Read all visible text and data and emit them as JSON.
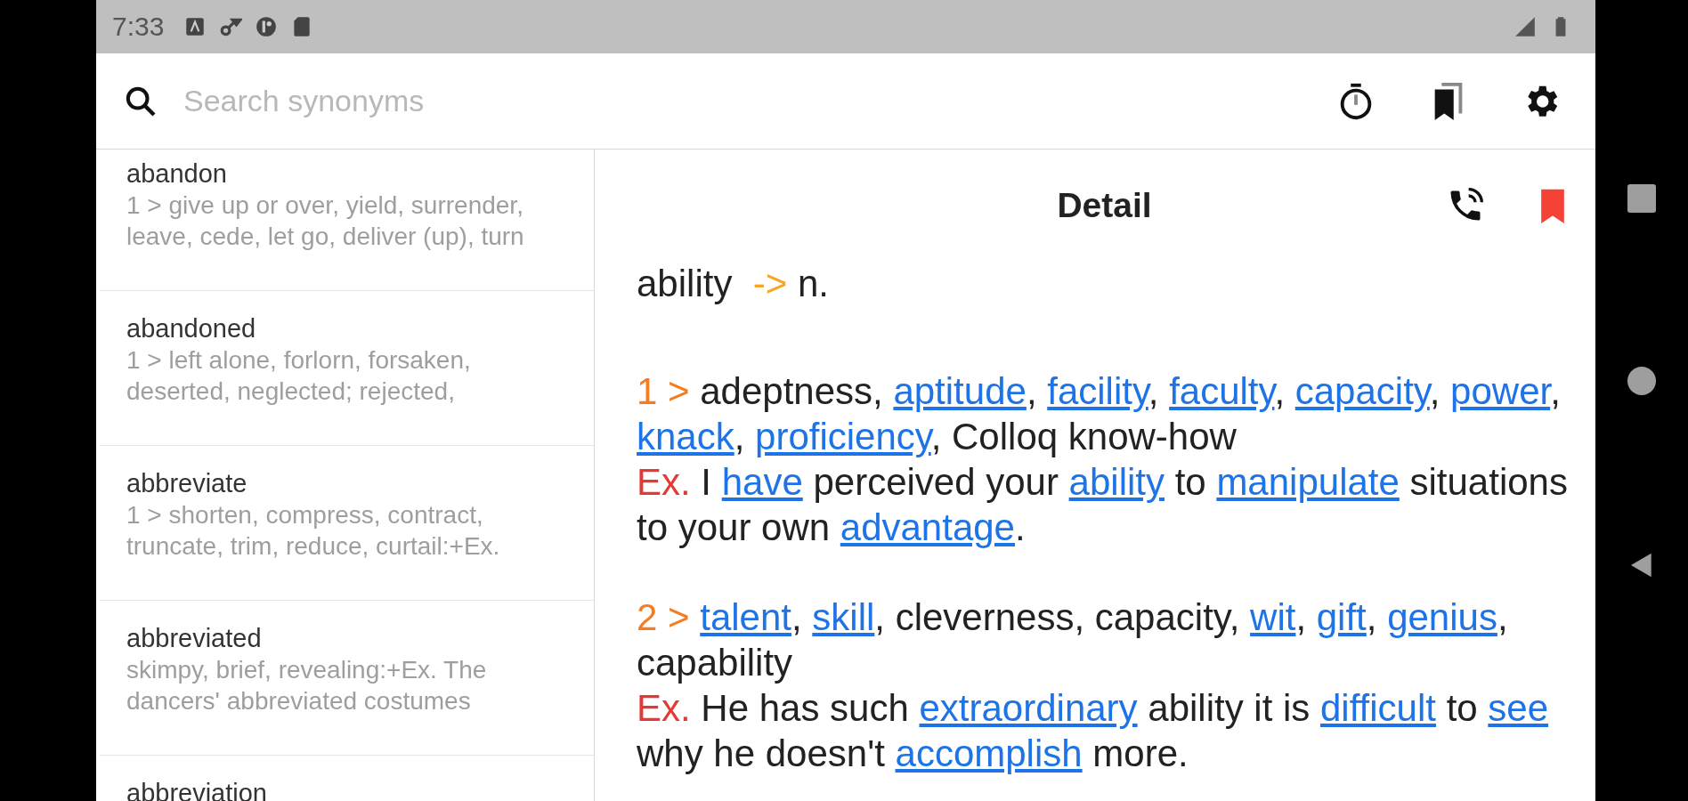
{
  "status_bar": {
    "time": "7:33"
  },
  "search": {
    "placeholder": "Search synonyms"
  },
  "word_list": [
    {
      "word": "abandon",
      "summary": [
        "1 > give up or over, yield, surrender,",
        "leave, cede, let go, deliver (up), turn"
      ]
    },
    {
      "word": "abandoned",
      "summary": [
        "1 > left alone, forlorn, forsaken,",
        "deserted, neglected; rejected,"
      ]
    },
    {
      "word": "abbreviate",
      "summary": [
        "1 > shorten, compress, contract,",
        "truncate, trim, reduce, curtail:+Ex."
      ]
    },
    {
      "word": "abbreviated",
      "summary": [
        "skimpy, brief, revealing:+Ex. The",
        "dancers' abbreviated costumes"
      ]
    },
    {
      "word": "abbreviation"
    }
  ],
  "detail": {
    "title": "Detail",
    "bookmarked": true,
    "entry": {
      "word": "ability",
      "arrow": "->",
      "pos": "n."
    },
    "senses": [
      {
        "number": "1 >",
        "definition": [
          {
            "kind": "plain",
            "text": "adeptness, "
          },
          {
            "kind": "link",
            "text": "aptitude"
          },
          {
            "kind": "plain",
            "text": ", "
          },
          {
            "kind": "link",
            "text": "facility"
          },
          {
            "kind": "plain",
            "text": ", "
          },
          {
            "kind": "link",
            "text": "faculty"
          },
          {
            "kind": "plain",
            "text": ", "
          },
          {
            "kind": "link",
            "text": "capacity"
          },
          {
            "kind": "plain",
            "text": ", "
          },
          {
            "kind": "link",
            "text": "power"
          },
          {
            "kind": "plain",
            "text": ", "
          },
          {
            "kind": "link",
            "text": "knack"
          },
          {
            "kind": "plain",
            "text": ", "
          },
          {
            "kind": "link",
            "text": "proficiency"
          },
          {
            "kind": "plain",
            "text": ", Colloq know-how"
          }
        ],
        "example_label": "Ex.",
        "example": [
          {
            "kind": "plain",
            "text": "I "
          },
          {
            "kind": "link",
            "text": "have"
          },
          {
            "kind": "plain",
            "text": " perceived your "
          },
          {
            "kind": "link",
            "text": "ability"
          },
          {
            "kind": "plain",
            "text": " to "
          },
          {
            "kind": "link",
            "text": "manipulate"
          },
          {
            "kind": "plain",
            "text": " situations to your own "
          },
          {
            "kind": "link",
            "text": "advantage"
          },
          {
            "kind": "plain",
            "text": "."
          }
        ]
      },
      {
        "number": "2 >",
        "definition": [
          {
            "kind": "link",
            "text": "talent"
          },
          {
            "kind": "plain",
            "text": ", "
          },
          {
            "kind": "link",
            "text": "skill"
          },
          {
            "kind": "plain",
            "text": ", cleverness, capacity, "
          },
          {
            "kind": "link",
            "text": "wit"
          },
          {
            "kind": "plain",
            "text": ", "
          },
          {
            "kind": "link",
            "text": "gift"
          },
          {
            "kind": "plain",
            "text": ", "
          },
          {
            "kind": "link",
            "text": "genius"
          },
          {
            "kind": "plain",
            "text": ", capability"
          }
        ],
        "example_label": "Ex.",
        "example": [
          {
            "kind": "plain",
            "text": "He has such "
          },
          {
            "kind": "link",
            "text": "extraordinary"
          },
          {
            "kind": "plain",
            "text": " ability it is "
          },
          {
            "kind": "link",
            "text": "difficult"
          },
          {
            "kind": "plain",
            "text": " to "
          },
          {
            "kind": "link",
            "text": "see"
          },
          {
            "kind": "plain",
            "text": " why he doesn't "
          },
          {
            "kind": "link",
            "text": "accomplish"
          },
          {
            "kind": "plain",
            "text": " more."
          }
        ]
      }
    ]
  }
}
